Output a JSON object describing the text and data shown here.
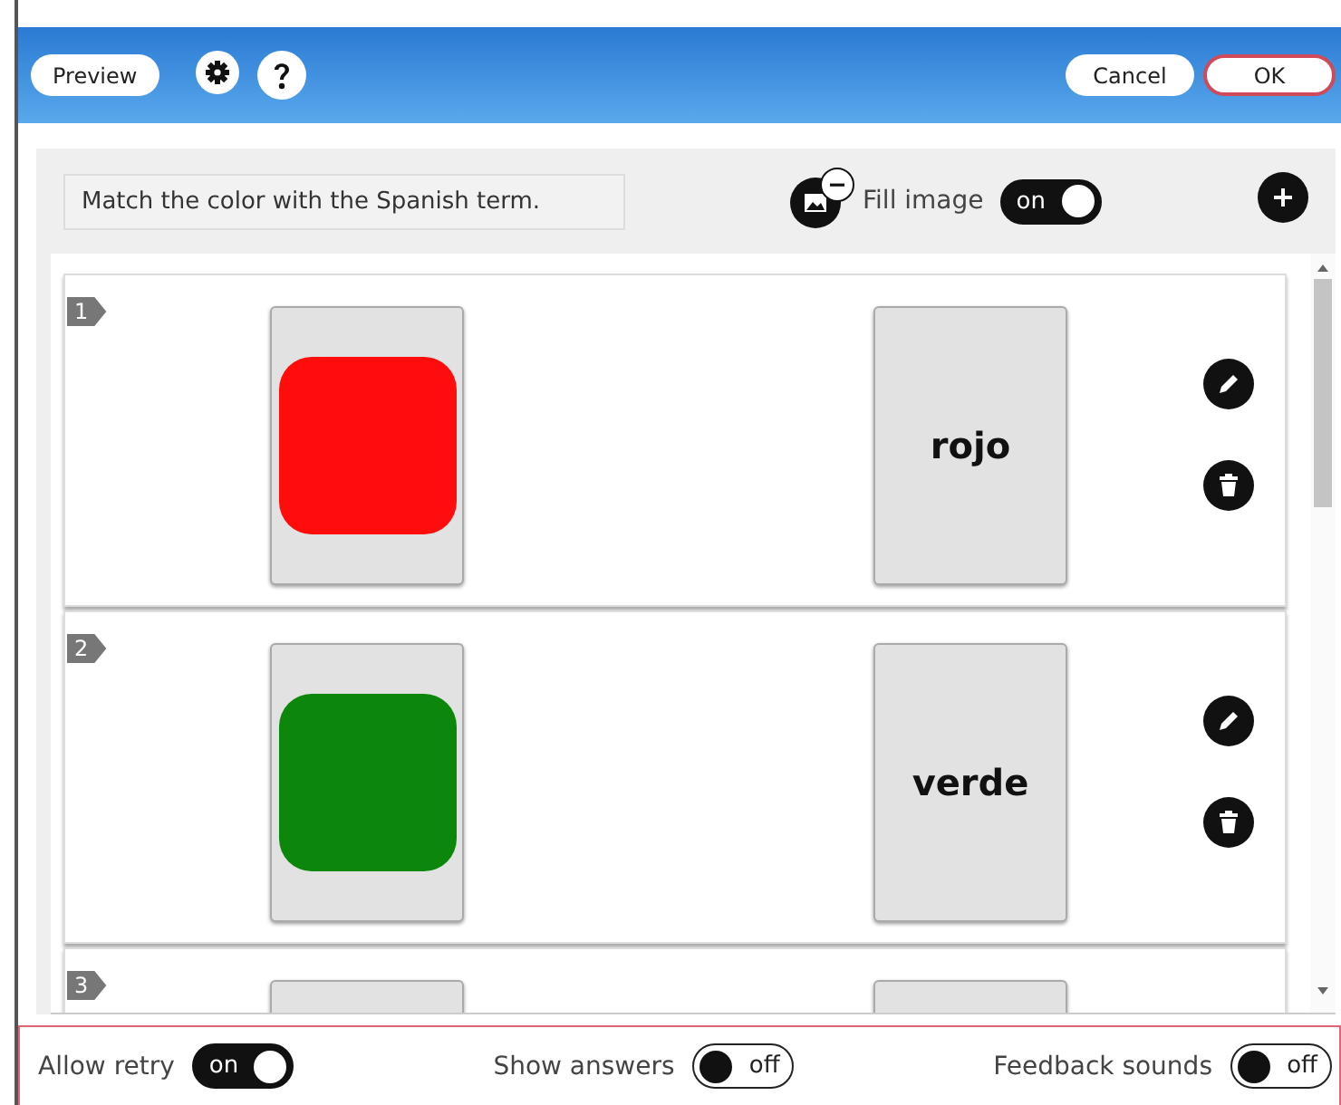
{
  "header": {
    "preview": "Preview",
    "cancel": "Cancel",
    "ok": "OK"
  },
  "toolbar": {
    "instruction": "Match the color with the Spanish term.",
    "fill_image": {
      "label": "Fill image",
      "on": true,
      "state_text": "on"
    }
  },
  "pairs": [
    {
      "number": "1",
      "color": "#ff0d0d",
      "term": "rojo"
    },
    {
      "number": "2",
      "color": "#0c870c",
      "term": "verde"
    },
    {
      "number": "3"
    }
  ],
  "footer": [
    {
      "label": "Allow retry",
      "on": true,
      "state_text": "on"
    },
    {
      "label": "Show answers",
      "on": false,
      "state_text": "off"
    },
    {
      "label": "Feedback sounds",
      "on": false,
      "state_text": "off"
    }
  ]
}
